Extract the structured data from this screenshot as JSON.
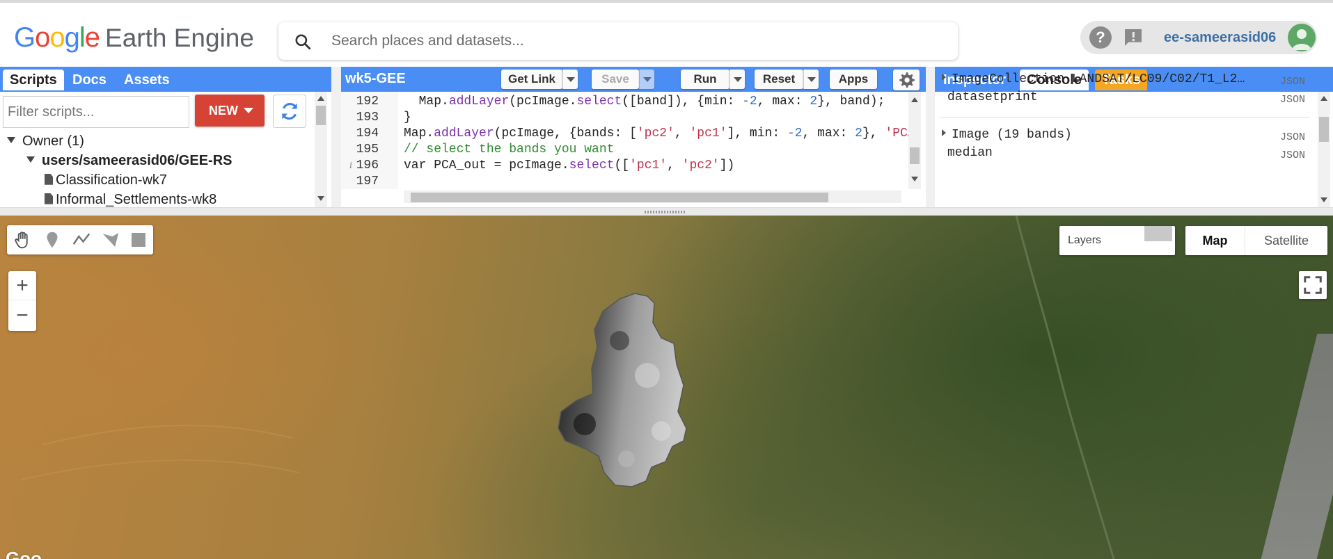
{
  "app": {
    "logo_letters": [
      "G",
      "o",
      "o",
      "g",
      "l",
      "e"
    ],
    "logo_product": "Earth Engine"
  },
  "search": {
    "placeholder": "Search places and datasets..."
  },
  "user": {
    "name": "ee-sameerasid06",
    "icons": [
      "help-icon",
      "feedback-icon",
      "avatar"
    ]
  },
  "left_panel": {
    "tabs": [
      {
        "label": "Scripts",
        "active": true
      },
      {
        "label": "Docs",
        "active": false
      },
      {
        "label": "Assets",
        "active": false
      }
    ],
    "filter_placeholder": "Filter scripts...",
    "new_button": "NEW",
    "tree": {
      "owner": "Owner (1)",
      "repo": "users/sameerasid06/GEE-RS",
      "files": [
        "Classification-wk7",
        "Informal_Settlements-wk8"
      ]
    }
  },
  "code_panel": {
    "script_name": "wk5-GEE",
    "buttons": {
      "get_link": "Get Link",
      "save": "Save",
      "run": "Run",
      "reset": "Reset",
      "apps": "Apps"
    },
    "lines": [
      {
        "num": "192",
        "segments": [
          {
            "t": "  ",
            "c": "plain"
          },
          {
            "t": "Map",
            "c": "plain"
          },
          {
            "t": ".",
            "c": "plain"
          },
          {
            "t": "addLayer",
            "c": "fn"
          },
          {
            "t": "(pcImage.",
            "c": "plain"
          },
          {
            "t": "select",
            "c": "fn"
          },
          {
            "t": "([band]), {min: ",
            "c": "plain"
          },
          {
            "t": "-2",
            "c": "num"
          },
          {
            "t": ", max: ",
            "c": "plain"
          },
          {
            "t": "2",
            "c": "num"
          },
          {
            "t": "}, band);",
            "c": "plain"
          }
        ]
      },
      {
        "num": "193",
        "segments": [
          {
            "t": "}",
            "c": "plain"
          }
        ]
      },
      {
        "num": "194",
        "segments": [
          {
            "t": "Map",
            "c": "plain"
          },
          {
            "t": ".",
            "c": "plain"
          },
          {
            "t": "addLayer",
            "c": "fn"
          },
          {
            "t": "(pcImage, {bands: [",
            "c": "plain"
          },
          {
            "t": "'pc2'",
            "c": "str"
          },
          {
            "t": ", ",
            "c": "plain"
          },
          {
            "t": "'pc1'",
            "c": "str"
          },
          {
            "t": "], min: ",
            "c": "plain"
          },
          {
            "t": "-2",
            "c": "num"
          },
          {
            "t": ", max: ",
            "c": "plain"
          },
          {
            "t": "2",
            "c": "num"
          },
          {
            "t": "}, ",
            "c": "plain"
          },
          {
            "t": "'PCA",
            "c": "str"
          }
        ]
      },
      {
        "num": "195",
        "segments": [
          {
            "t": "// select the bands you want",
            "c": "com"
          }
        ]
      },
      {
        "num": "196",
        "info": "i",
        "segments": [
          {
            "t": "var PCA_out = pcImage.",
            "c": "plain"
          },
          {
            "t": "select",
            "c": "fn"
          },
          {
            "t": "([",
            "c": "plain"
          },
          {
            "t": "'pc1'",
            "c": "str"
          },
          {
            "t": ", ",
            "c": "plain"
          },
          {
            "t": "'pc2'",
            "c": "str"
          },
          {
            "t": "])",
            "c": "plain"
          }
        ]
      },
      {
        "num": "197",
        "segments": []
      }
    ]
  },
  "right_panel": {
    "tabs": [
      {
        "label": "Inspector",
        "active": false
      },
      {
        "label": "Console",
        "active": true
      },
      {
        "label": "Tasks",
        "active": false
      }
    ],
    "console": [
      {
        "text": "ImageCollection LANDSAT/LC09/C02/T1_L2…",
        "expandable": true,
        "tag": "JSON"
      },
      {
        "text": "datasetprint",
        "expandable": false,
        "tag": "JSON"
      },
      {
        "text": "Image (19 bands)",
        "expandable": true,
        "tag": "JSON"
      },
      {
        "text": "median",
        "expandable": false,
        "tag": "JSON"
      }
    ]
  },
  "map": {
    "tools": [
      "pan-hand-icon",
      "marker-icon",
      "line-icon",
      "polygon-icon",
      "rectangle-icon"
    ],
    "zoom_in": "+",
    "zoom_out": "−",
    "layers_label": "Layers",
    "map_type": {
      "map": "Map",
      "satellite": "Satellite",
      "selected": "Map"
    },
    "attribution": "Goo"
  },
  "colors": {
    "panel_bar": "#4a8ef5",
    "new_button": "#d64234",
    "tasks_tab": "#f5a623",
    "username": "#3d6fa6"
  }
}
